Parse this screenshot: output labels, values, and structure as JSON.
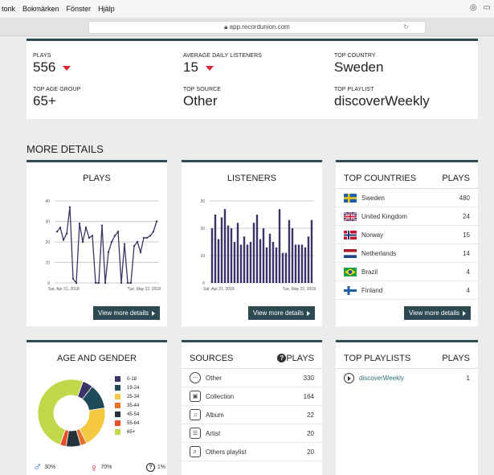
{
  "menubar": {
    "items": [
      "torik",
      "Bokmärken",
      "Fönster",
      "Hjälp"
    ]
  },
  "browser": {
    "url": "app.recordunion.com"
  },
  "summary": {
    "plays": {
      "label": "PLAYS",
      "value": "556"
    },
    "avg_listeners": {
      "label": "AVERAGE DAILY LISTENERS",
      "value": "15"
    },
    "top_country": {
      "label": "TOP COUNTRY",
      "value": "Sweden"
    },
    "top_age": {
      "label": "TOP AGE GROUP",
      "value": "65+"
    },
    "top_source": {
      "label": "TOP SOURCE",
      "value": "Other"
    },
    "top_playlist": {
      "label": "TOP PLAYLIST",
      "value": "discoverWeekly"
    },
    "down_color": "#d9232e"
  },
  "section_title": "MORE DETAILS",
  "view_more_label": "View more details",
  "chart_data": [
    {
      "type": "line",
      "title": "PLAYS",
      "x_start": "Sat, Apr 21, 2018",
      "x_end": "Tue, May 22, 2018",
      "ylim": [
        0,
        40
      ],
      "yticks": [
        0,
        10,
        20,
        30,
        40
      ],
      "values": [
        25,
        27,
        21,
        24,
        37,
        2,
        0,
        29,
        20,
        27,
        22,
        23,
        0,
        0,
        28,
        0,
        15,
        20,
        23,
        25,
        0,
        19,
        0,
        0,
        18,
        20,
        15,
        22,
        22,
        23,
        25,
        30
      ],
      "color": "#3b3466"
    },
    {
      "type": "bar",
      "title": "LISTENERS",
      "x_start": "Sat, Apr 21, 2018",
      "x_end": "Tue, May 22, 2018",
      "ylim": [
        0,
        30
      ],
      "yticks": [
        0,
        10,
        20,
        30
      ],
      "values": [
        20,
        25,
        16,
        24,
        27,
        21,
        20,
        15,
        22,
        14,
        17,
        14,
        15,
        22,
        25,
        16,
        20,
        13,
        18,
        15,
        13,
        27,
        11,
        11,
        23,
        20,
        14,
        14,
        14,
        13,
        17,
        23
      ],
      "color": "#3b3466"
    },
    {
      "type": "pie",
      "title": "AGE AND GENDER",
      "categories": [
        "0-18",
        "19-24",
        "25-34",
        "35-44",
        "45-54",
        "55-64",
        "65+"
      ],
      "values": [
        5,
        12,
        20,
        3,
        7,
        3,
        50
      ],
      "colors": [
        "#3b3466",
        "#1f4a5a",
        "#f5c842",
        "#e8702a",
        "#26323b",
        "#e84e2a",
        "#c3d74b"
      ]
    }
  ],
  "top_countries": {
    "title": "TOP COUNTRIES",
    "col": "PLAYS",
    "rows": [
      {
        "name": "Sweden",
        "plays": "480",
        "flag": "sweden"
      },
      {
        "name": "United Kingdom",
        "plays": "24",
        "flag": "uk"
      },
      {
        "name": "Norway",
        "plays": "15",
        "flag": "norway"
      },
      {
        "name": "Netherlands",
        "plays": "14",
        "flag": "netherlands"
      },
      {
        "name": "Brazil",
        "plays": "4",
        "flag": "brazil"
      },
      {
        "name": "Finland",
        "plays": "4",
        "flag": "finland"
      }
    ]
  },
  "gender": {
    "male": "30%",
    "female": "70%",
    "unknown": "1%",
    "male_color": "#1f6fd6",
    "female_color": "#d9232e"
  },
  "sources": {
    "title": "SOURCES",
    "col": "PLAYS",
    "rows": [
      {
        "name": "Other",
        "plays": "330",
        "icon": "other-icon"
      },
      {
        "name": "Collection",
        "plays": "164",
        "icon": "collection-icon"
      },
      {
        "name": "Album",
        "plays": "22",
        "icon": "album-icon"
      },
      {
        "name": "Artist",
        "plays": "20",
        "icon": "artist-icon"
      },
      {
        "name": "Others playlist",
        "plays": "20",
        "icon": "playlist-icon"
      }
    ]
  },
  "top_playlists": {
    "title": "TOP PLAYLISTS",
    "col": "PLAYS",
    "rows": [
      {
        "name": "discoverWeekly",
        "plays": "1"
      }
    ],
    "link_color": "#2d6e7a"
  }
}
